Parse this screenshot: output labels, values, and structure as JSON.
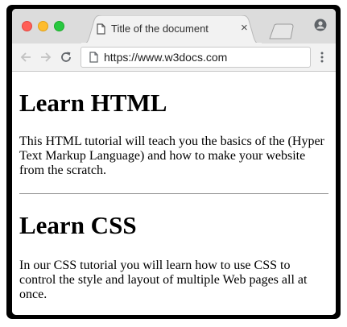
{
  "browser": {
    "tab": {
      "title": "Title of the document",
      "close_glyph": "×"
    },
    "address_bar": {
      "url": "https://www.w3docs.com"
    },
    "icons": {
      "tab": "document-icon",
      "back": "back-arrow-icon",
      "forward": "forward-arrow-icon",
      "reload": "reload-icon",
      "address": "page-icon",
      "menu": "kebab-menu-icon",
      "profile": "profile-icon"
    }
  },
  "content": {
    "sections": [
      {
        "heading": "Learn HTML",
        "text": "This HTML tutorial will teach you the basics of the (Hyper Text Markup Language) and how to make your website from the scratch."
      },
      {
        "heading": "Learn CSS",
        "text": "In our CSS tutorial you will learn how to use CSS to control the style and layout of multiple Web pages all at once."
      }
    ]
  },
  "colors": {
    "window_frame": "#000000",
    "tab_strip": "#dcdcdc",
    "toolbar": "#f2f2f2",
    "close_light": "#ff5f57",
    "minimize_light": "#febc2e",
    "maximize_light": "#28c840"
  }
}
